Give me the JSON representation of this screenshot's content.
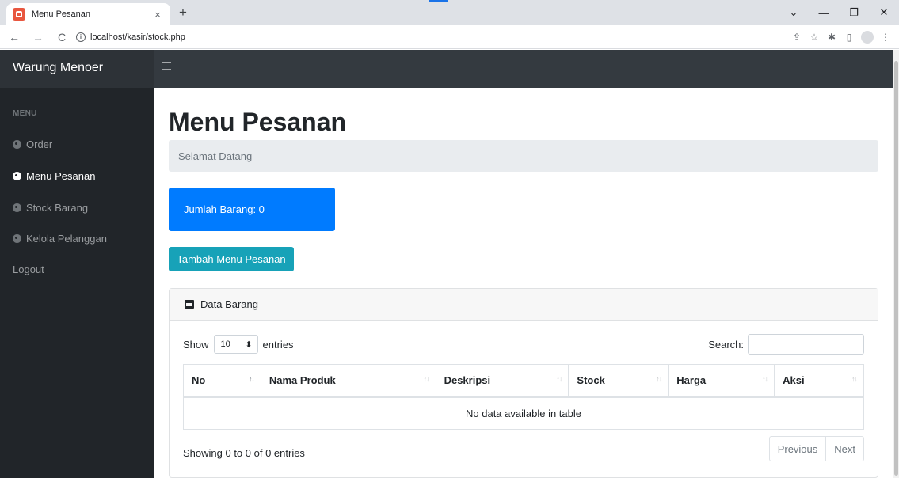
{
  "browser": {
    "tab_title": "Menu Pesanan",
    "tab_close": "×",
    "new_tab": "+",
    "url": "localhost/kasir/stock.php",
    "win_min": "—",
    "win_restore": "❐",
    "win_close": "✕",
    "win_menu": "⌄",
    "back": "←",
    "forward": "→",
    "reload": "C"
  },
  "app": {
    "brand": "Warung Menoer",
    "sidebar": {
      "heading": "MENU",
      "items": [
        {
          "label": "Order",
          "icon": "dashboard-icon",
          "active": false
        },
        {
          "label": "Menu Pesanan",
          "icon": "dashboard-icon",
          "active": true
        },
        {
          "label": "Stock Barang",
          "icon": "dashboard-icon",
          "active": false
        },
        {
          "label": "Kelola Pelanggan",
          "icon": "dashboard-icon",
          "active": false
        }
      ],
      "logout": "Logout"
    }
  },
  "main": {
    "title": "Menu Pesanan",
    "breadcrumb": "Selamat Datang",
    "stat_card": "Jumlah Barang: 0",
    "add_button": "Tambah Menu Pesanan",
    "card_title": "Data Barang",
    "length": {
      "show": "Show",
      "value": "10",
      "entries": "entries"
    },
    "search_label": "Search:",
    "search_value": "",
    "columns": [
      "No",
      "Nama Produk",
      "Deskripsi",
      "Stock",
      "Harga",
      "Aksi"
    ],
    "empty": "No data available in table",
    "info": "Showing 0 to 0 of 0 entries",
    "pager": {
      "prev": "Previous",
      "next": "Next"
    }
  },
  "colors": {
    "topnav": "#343a40",
    "sidebar": "#212529",
    "primary": "#007bff",
    "info": "#17a2b8"
  }
}
